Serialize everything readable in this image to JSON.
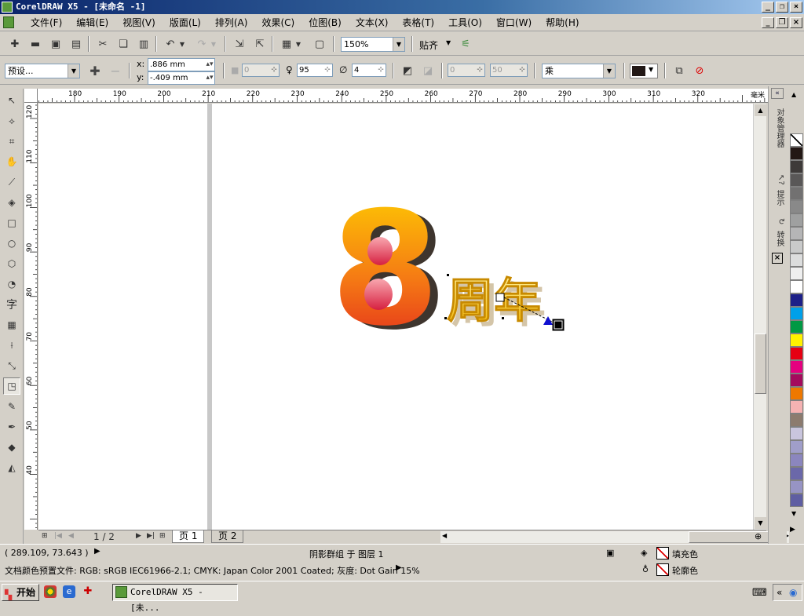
{
  "window": {
    "title": "CorelDRAW X5 - [未命名 -1]"
  },
  "menu": [
    "文件(F)",
    "编辑(E)",
    "视图(V)",
    "版面(L)",
    "排列(A)",
    "效果(C)",
    "位图(B)",
    "文本(X)",
    "表格(T)",
    "工具(O)",
    "窗口(W)",
    "帮助(H)"
  ],
  "toolbar": {
    "zoom": "150%",
    "snap_label": "贴齐"
  },
  "property_bar": {
    "preset": "预设...",
    "x_label": "x:",
    "x_value": ".886 mm",
    "y_label": "y:",
    "y_value": "-.409 mm",
    "shadow_offset": "0",
    "opacity": "95",
    "feather": "4",
    "fade": "0",
    "stretch": "50",
    "blend_mode": "乘",
    "shadow_color": "#221816"
  },
  "ruler": {
    "h_labels": [
      "180",
      "190",
      "200",
      "210",
      "220",
      "230",
      "240",
      "250",
      "260",
      "270",
      "280",
      "290",
      "300",
      "310",
      "320"
    ],
    "v_labels": [
      "120",
      "110",
      "100",
      "90",
      "80",
      "70",
      "60",
      "50",
      "40"
    ],
    "unit": "毫米"
  },
  "canvas": {
    "numeral": "8",
    "caption": "周年"
  },
  "page_nav": {
    "counter": "1 / 2",
    "tabs": [
      "页 1",
      "页 2"
    ]
  },
  "docker_tabs": [
    "对象管理器",
    "提示",
    "转换"
  ],
  "palette": [
    "#ffffff",
    "#231815",
    "#3e3a39",
    "#595757",
    "#727171",
    "#898989",
    "#9fa0a0",
    "#b5b5b6",
    "#c9caca",
    "#dcdddd",
    "#efefef",
    "#ffffff",
    "#1d2088",
    "#00a0e9",
    "#009944",
    "#fff100",
    "#e60012",
    "#e4007f",
    "#a40b5d",
    "#ee7800",
    "#f5b2b2",
    "#8c7b6e",
    "#c9c5dd",
    "#a09ec9",
    "#8b86be",
    "#6b68a9",
    "#9794c4",
    "#5f5ea2"
  ],
  "status": {
    "coords": "( 289.109, 73.643 )",
    "selection": "阴影群组 于 图层 1",
    "color_profile": "文档颜色预置文件: RGB: sRGB IEC61966-2.1; CMYK: Japan Color 2001 Coated; 灰度: Dot Gain 15%",
    "fill_label": "填充色",
    "outline_label": "轮廓色"
  },
  "taskbar": {
    "start": "开始",
    "task": "CorelDRAW X5 - [未..."
  }
}
